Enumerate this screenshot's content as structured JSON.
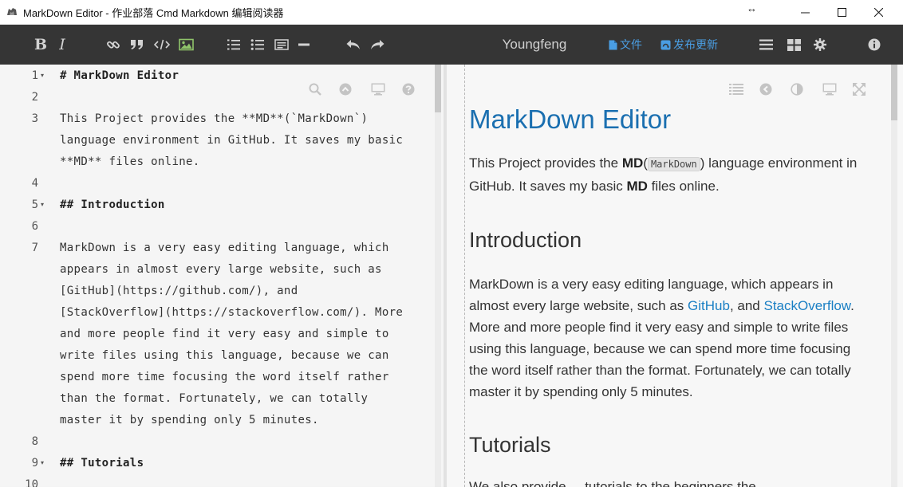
{
  "window": {
    "title": "MarkDown Editor - 作业部落 Cmd Markdown 编辑阅读器",
    "resize_glyph": "↔"
  },
  "toolbar": {
    "bold_label": "B",
    "italic_label": "I",
    "author": "Youngfeng",
    "file_label": "文件",
    "publish_label": "发布更新",
    "accent_color": "#4a9ee3"
  },
  "editor": {
    "lines": [
      {
        "num": "1",
        "fold": "▾",
        "text": "# MarkDown Editor"
      },
      {
        "num": "2",
        "fold": "",
        "text": ""
      },
      {
        "num": "3",
        "fold": "",
        "text": "This Project provides the **MD**(`MarkDown`)"
      },
      {
        "num": "",
        "fold": "",
        "text": "language environment in GitHub. It saves my basic"
      },
      {
        "num": "",
        "fold": "",
        "text": "**MD** files online."
      },
      {
        "num": "4",
        "fold": "",
        "text": ""
      },
      {
        "num": "5",
        "fold": "▾",
        "text": "## Introduction"
      },
      {
        "num": "6",
        "fold": "",
        "text": ""
      },
      {
        "num": "7",
        "fold": "",
        "text": "MarkDown is a very easy editing language, which"
      },
      {
        "num": "",
        "fold": "",
        "text": "appears in almost every large website, such as"
      },
      {
        "num": "",
        "fold": "",
        "text": "[GitHub](https://github.com/), and"
      },
      {
        "num": "",
        "fold": "",
        "text": "[StackOverflow](https://stackoverflow.com/). More"
      },
      {
        "num": "",
        "fold": "",
        "text": "and more people find it very easy and simple to"
      },
      {
        "num": "",
        "fold": "",
        "text": "write files using this language, because we can"
      },
      {
        "num": "",
        "fold": "",
        "text": "spend more time focusing the word itself rather"
      },
      {
        "num": "",
        "fold": "",
        "text": "than the format. Fortunately, we can totally"
      },
      {
        "num": "",
        "fold": "",
        "text": "master it by spending only 5 minutes."
      },
      {
        "num": "8",
        "fold": "",
        "text": ""
      },
      {
        "num": "9",
        "fold": "▾",
        "text": "## Tutorials"
      },
      {
        "num": "10",
        "fold": "",
        "text": ""
      }
    ]
  },
  "preview": {
    "h1": "MarkDown Editor",
    "p1": {
      "before": "This Project provides the ",
      "bold1": "MD",
      "paren_open": "(",
      "code": "MarkDown",
      "after1": ") language environment in GitHub. It saves my basic ",
      "bold2": "MD",
      "after2": " files online."
    },
    "h2_intro": "Introduction",
    "p2": {
      "before": "MarkDown is a very easy editing language, which appears in almost every large website, such as ",
      "link1": "GitHub",
      "mid": ", and ",
      "link2": "StackOverflow",
      "after": ". More and more people find it very easy and simple to write files using this language, because we can spend more time focusing the word itself rather than the format. Fortunately, we can totally master it by spending only 5 minutes."
    },
    "h2_tutorials": "Tutorials",
    "cut_text": "We also provide ... tutorials to the beginners the ..."
  }
}
